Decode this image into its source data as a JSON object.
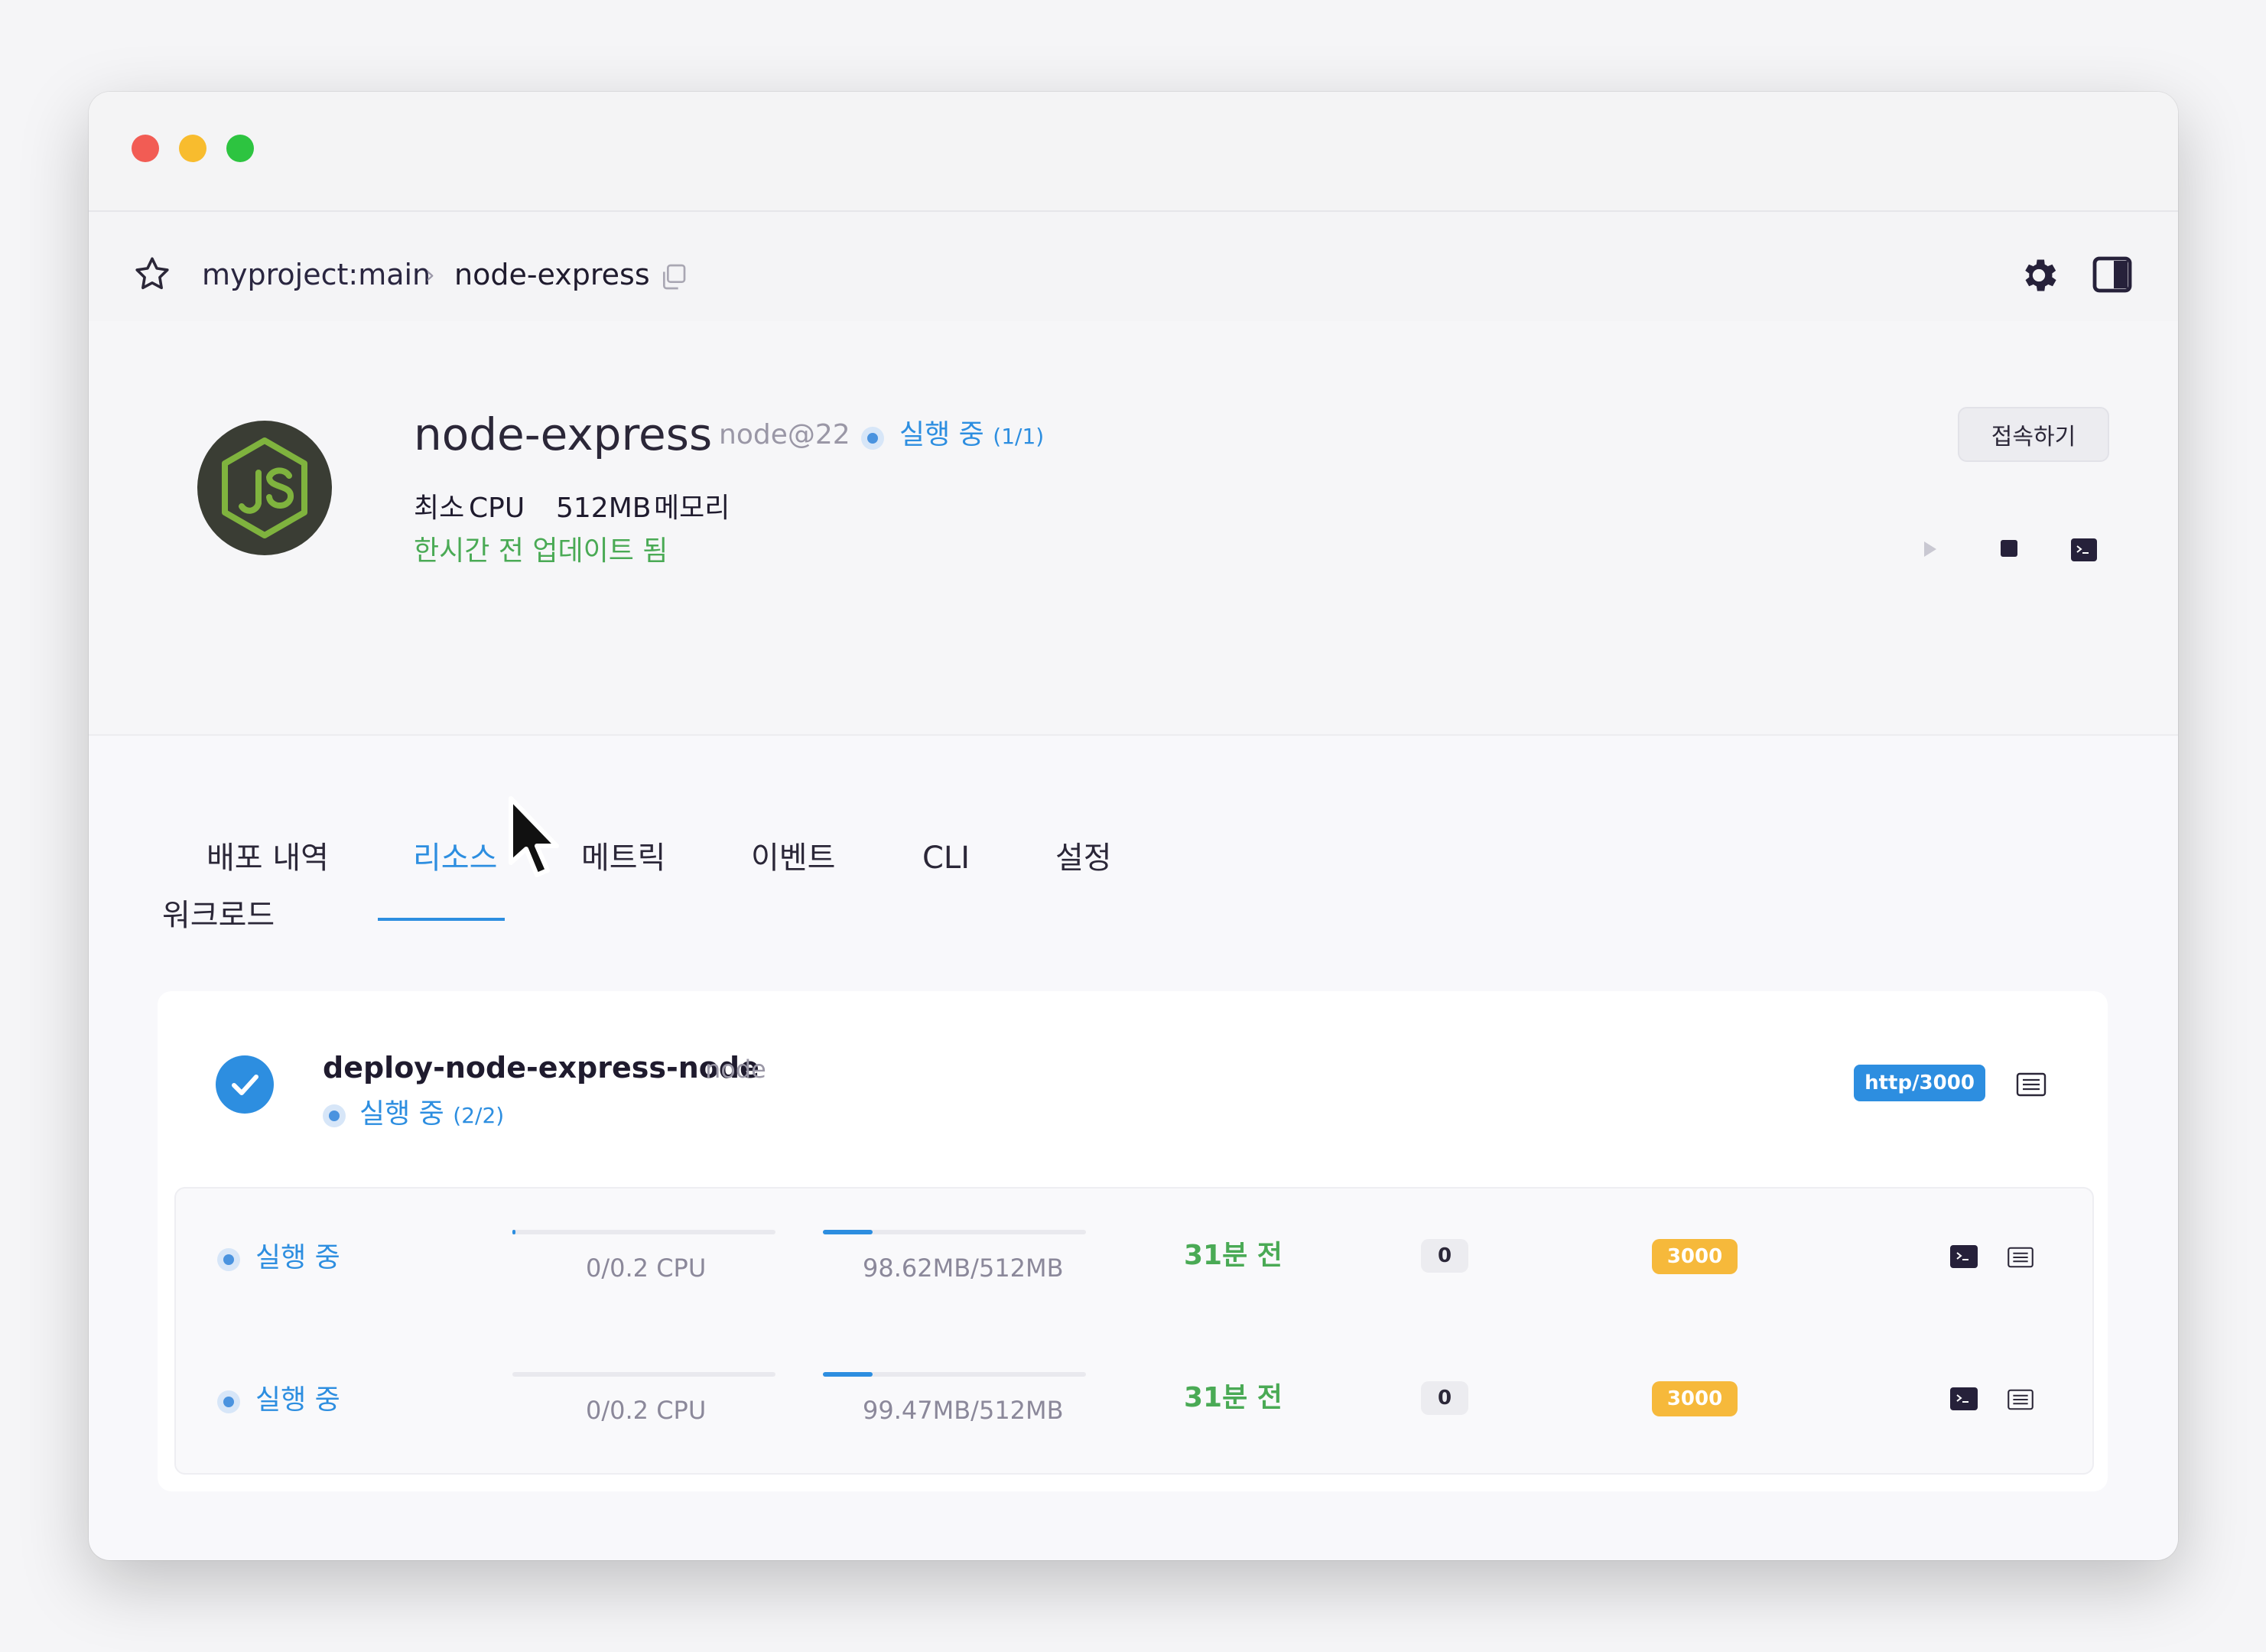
{
  "breadcrumb": {
    "project": "myproject:main",
    "separator": "›",
    "service": "node-express"
  },
  "service": {
    "name": "node-express",
    "image_tag": "node@22",
    "status_text": "실행 중",
    "status_count": "(1/1)",
    "cpu_value": "최소",
    "cpu_label": "CPU",
    "memory_value": "512MB",
    "memory_label": "메모리",
    "updated": "한시간 전 업데이트 됨",
    "connect_label": "접속하기"
  },
  "tabs": [
    {
      "label": "배포 내역",
      "active": false
    },
    {
      "label": "리소스",
      "active": true
    },
    {
      "label": "메트릭",
      "active": false
    },
    {
      "label": "이벤트",
      "active": false
    },
    {
      "label": "CLI",
      "active": false
    },
    {
      "label": "설정",
      "active": false
    }
  ],
  "workloads": {
    "title": "워크로드",
    "deployment": {
      "name": "deploy-node-express-node",
      "tag": "node",
      "status_text": "실행 중",
      "status_count": "(2/2)",
      "port_badge": "http/3000"
    },
    "pods": [
      {
        "status": "실행 중",
        "cpu_text": "0/0.2 CPU",
        "cpu_fraction": 0.0,
        "memory_text": "98.62MB/512MB",
        "memory_fraction": 0.19,
        "age": "31분 전",
        "restarts": "0",
        "port": "3000"
      },
      {
        "status": "실행 중",
        "cpu_text": "0/0.2 CPU",
        "cpu_fraction": 0.0,
        "memory_text": "99.47MB/512MB",
        "memory_fraction": 0.19,
        "age": "31분 전",
        "restarts": "0",
        "port": "3000"
      }
    ]
  },
  "colors": {
    "accent": "#2d8ee0",
    "success": "#4aaa55",
    "port": "#f6b93b",
    "dark": "#26213a"
  },
  "icons": [
    "star-icon",
    "copy-icon",
    "gear-icon",
    "panel-toggle-icon",
    "nodejs-logo",
    "play-icon",
    "stop-icon",
    "terminal-icon",
    "check-icon",
    "logs-icon",
    "cursor-icon"
  ]
}
